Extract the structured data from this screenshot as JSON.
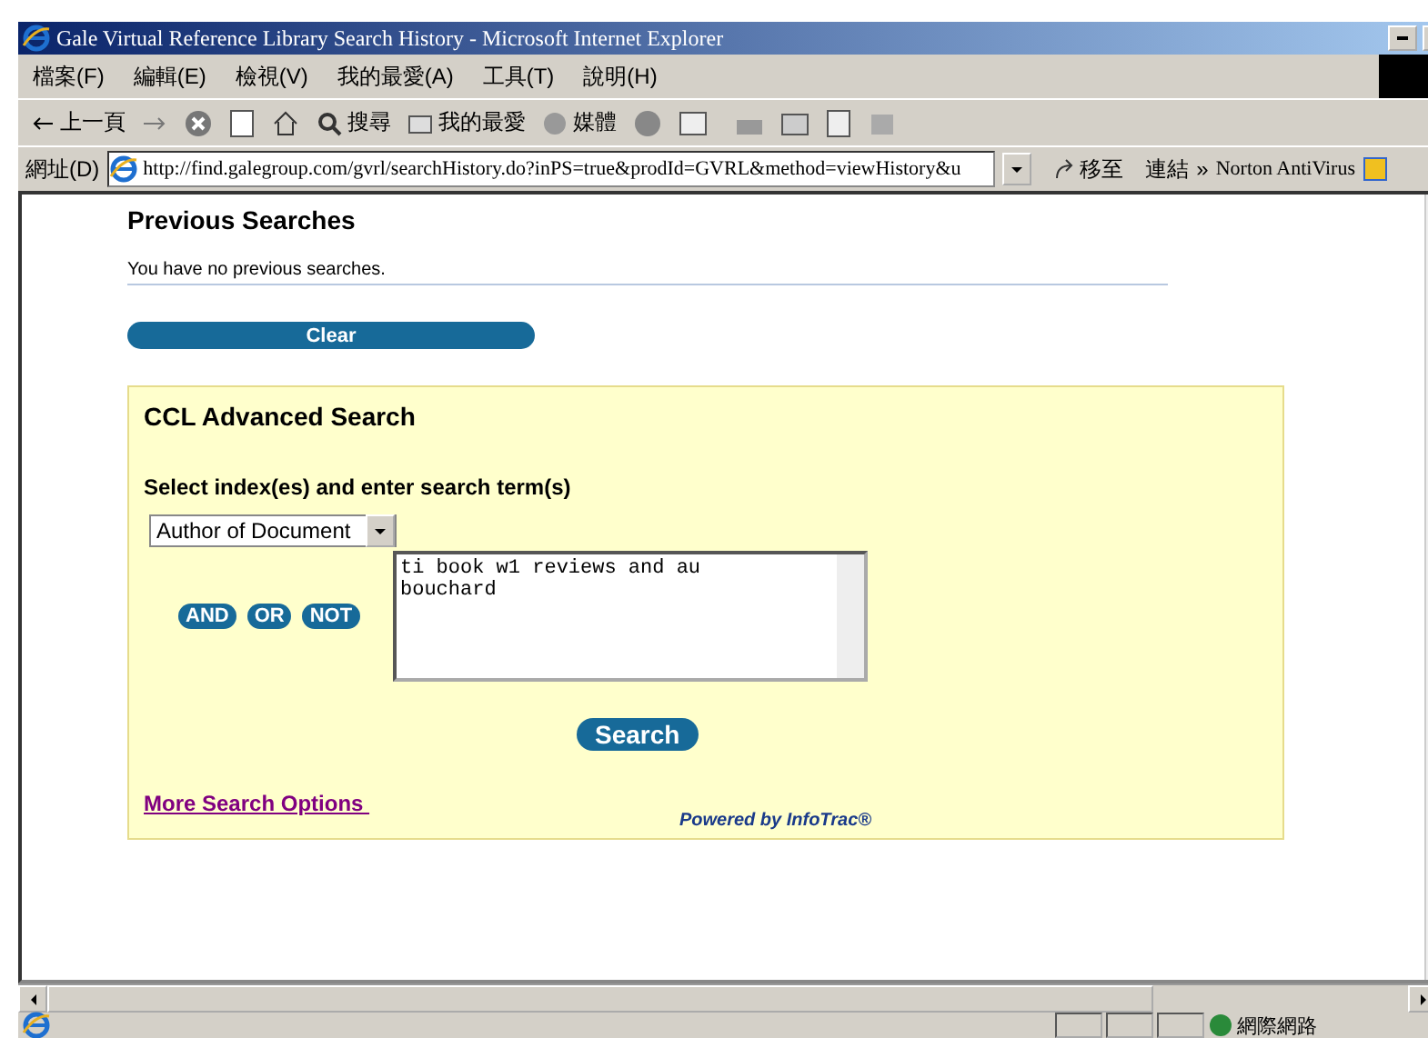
{
  "window": {
    "title": "Gale Virtual Reference Library Search History - Microsoft Internet Explorer"
  },
  "menu": [
    "檔案(F)",
    "編輯(E)",
    "檢視(V)",
    "我的最愛(A)",
    "工具(T)",
    "說明(H)"
  ],
  "toolbar": {
    "back": "上一頁",
    "search": "搜尋",
    "favorites": "我的最愛",
    "media": "媒體"
  },
  "address_bar": {
    "label": "網址(D)",
    "url": "http://find.galegroup.com/gvrl/searchHistory.do?inPS=true&prodId=GVRL&method=viewHistory&u",
    "go": "移至",
    "links": "連結",
    "chevron": "»",
    "norton": "Norton AntiVirus"
  },
  "previous_searches": {
    "title": "Previous Searches",
    "message": "You have no previous searches.",
    "clear_button": "Clear"
  },
  "advanced_search": {
    "title": "CCL Advanced Search",
    "instruction": "Select index(es) and enter search term(s)",
    "index_select": "Author of Document",
    "operators": [
      "AND",
      "OR",
      "NOT"
    ],
    "query": "ti book w1 reviews and au\nbouchard",
    "search_button": "Search",
    "more_options": "More Search Options ",
    "powered_by": "Powered by InfoTrac®"
  },
  "status_bar": {
    "zone": "網際網路"
  }
}
